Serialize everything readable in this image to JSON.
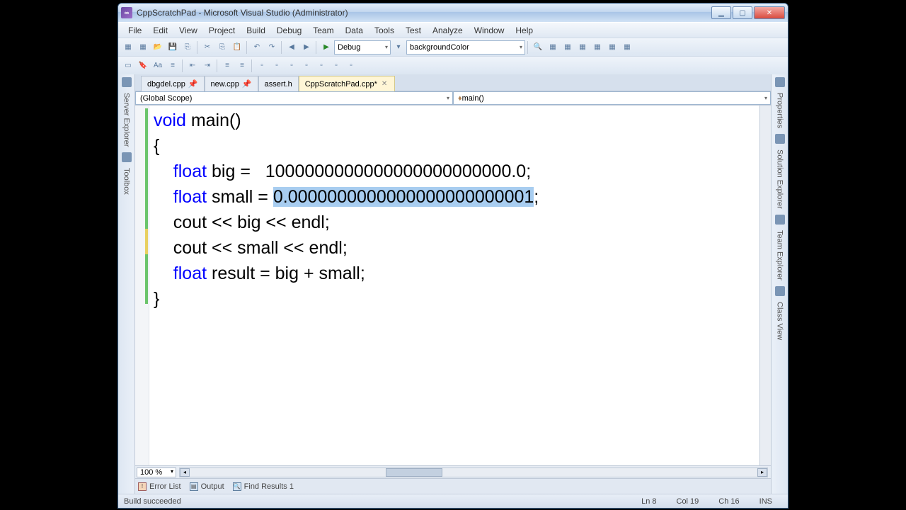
{
  "window": {
    "title": "CppScratchPad - Microsoft Visual Studio (Administrator)"
  },
  "menu": {
    "items": [
      "File",
      "Edit",
      "View",
      "Project",
      "Build",
      "Debug",
      "Team",
      "Data",
      "Tools",
      "Test",
      "Analyze",
      "Window",
      "Help"
    ]
  },
  "toolbar": {
    "config_dropdown": "Debug",
    "find_dropdown": "backgroundColor"
  },
  "tabs": [
    {
      "label": "dbgdel.cpp",
      "pinned": true,
      "active": false
    },
    {
      "label": "new.cpp",
      "pinned": true,
      "active": false
    },
    {
      "label": "assert.h",
      "pinned": false,
      "active": false
    },
    {
      "label": "CppScratchPad.cpp*",
      "pinned": false,
      "active": true
    }
  ],
  "scope": {
    "left": "(Global Scope)",
    "right": "main()"
  },
  "left_panels": [
    "Server Explorer",
    "Toolbox"
  ],
  "right_panels": [
    "Properties",
    "Solution Explorer",
    "Team Explorer",
    "Class View"
  ],
  "code": {
    "line1_a": "void",
    "line1_b": " main()",
    "line2": "{",
    "line3_a": "    ",
    "line3_kw": "float",
    "line3_b": " big =   1000000000000000000000000.0;",
    "line4_a": "    ",
    "line4_kw": "float",
    "line4_b": " small = ",
    "line4_sel": "0.0000000000000000000000001",
    "line4_c": ";",
    "line5": "    cout << big << endl;",
    "line6": "    cout << small << endl;",
    "line7_a": "    ",
    "line7_kw": "float",
    "line7_b": " result = big + small;",
    "line8": "}"
  },
  "zoom": "100 %",
  "bottom_tabs": {
    "error_list": "Error List",
    "output": "Output",
    "find_results": "Find Results 1"
  },
  "status": {
    "message": "Build succeeded",
    "line": "Ln 8",
    "col": "Col 19",
    "ch": "Ch 16",
    "mode": "INS"
  }
}
